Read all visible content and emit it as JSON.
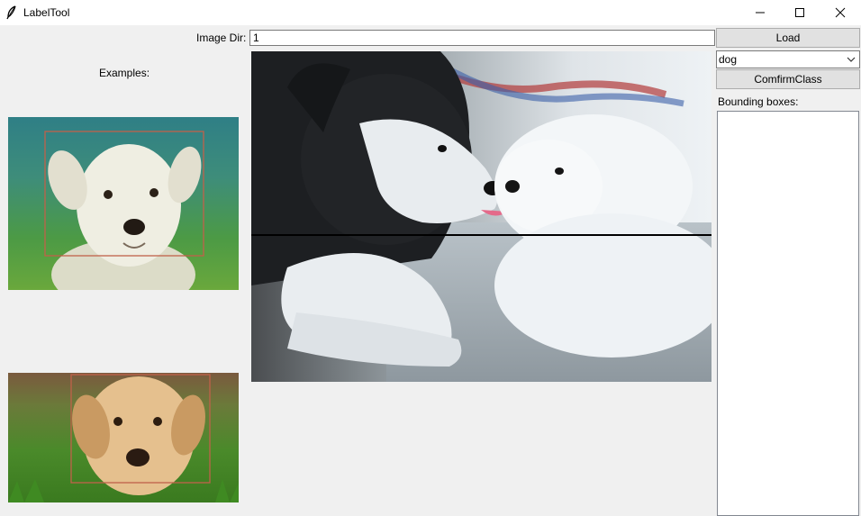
{
  "window": {
    "title": "LabelTool",
    "icon": "feather-icon"
  },
  "controls": {
    "image_dir_label": "Image Dir:",
    "image_dir_value": "1",
    "load_label": "Load",
    "class_selected": "dog",
    "confirm_label": "ComfirmClass",
    "bbox_label": "Bounding boxes:"
  },
  "examples": {
    "label": "Examples:"
  },
  "colors": {
    "bbox_outline": "#c0614a",
    "crosshair": "#000000"
  }
}
